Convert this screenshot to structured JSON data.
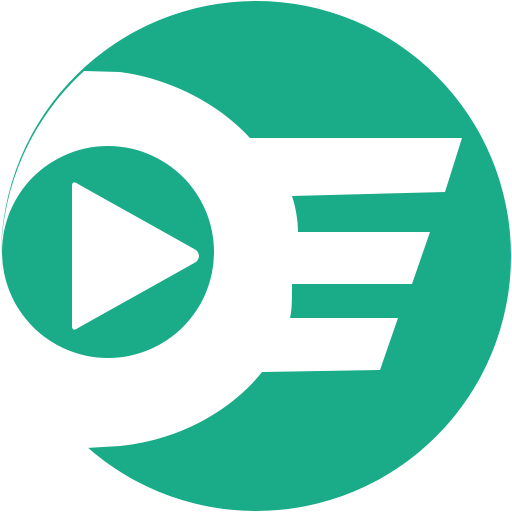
{
  "logo": {
    "brand_color": "#1aab88",
    "foreground_color": "#ffffff",
    "icon_name": "play-speed-logo-icon"
  }
}
